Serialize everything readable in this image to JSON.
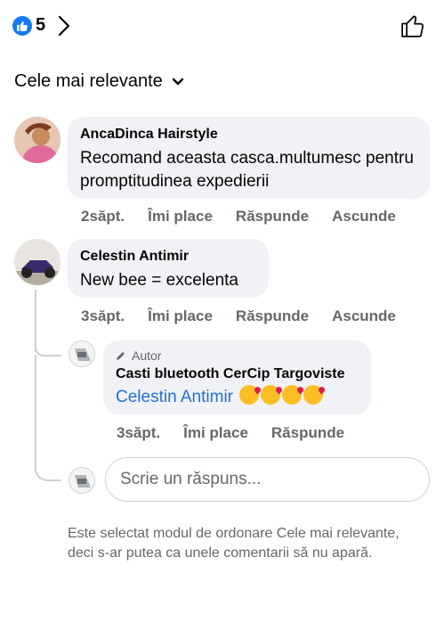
{
  "header": {
    "like_count": "5"
  },
  "sort": {
    "label": "Cele mai relevante"
  },
  "comments": [
    {
      "author": "AncaDinca Hairstyle",
      "text": "Recomand aceasta casca.multumesc pentru promptitudinea expedierii",
      "time": "2săpt.",
      "like": "Îmi place",
      "reply": "Răspunde",
      "hide": "Ascunde"
    },
    {
      "author": "Celestin Antimir",
      "text": "New bee = excelenta",
      "time": "3săpt.",
      "like": "Îmi place",
      "reply": "Răspunde",
      "hide": "Ascunde"
    }
  ],
  "reply": {
    "badge": "Autor",
    "author": "Casti bluetooth CerCip Targoviste",
    "mention": "Celestin Antimir",
    "time": "3săpt.",
    "like": "Îmi place",
    "reply": "Răspunde"
  },
  "reply_input": {
    "placeholder": "Scrie un răspuns..."
  },
  "footnote": "Este selectat modul de ordonare Cele mai relevante, deci s-ar putea ca unele comentarii să nu apară.",
  "colors": {
    "accent": "#1877f2",
    "link": "#216fdb",
    "bubble": "#f0f2f5",
    "muted": "#65676b"
  }
}
